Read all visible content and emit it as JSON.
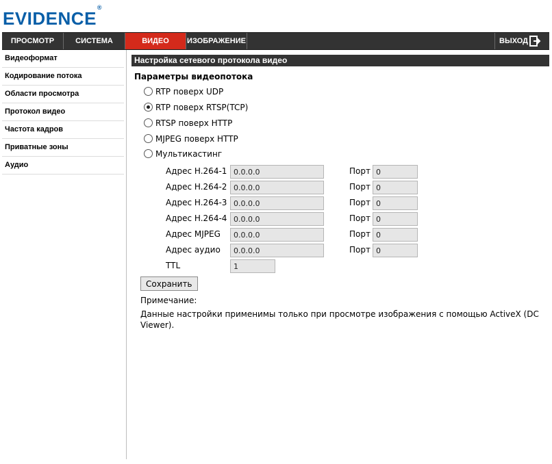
{
  "brand": {
    "logo_text": "EVIDENCE",
    "logo_mark": "®",
    "color": "#0a5fa8"
  },
  "topnav": {
    "tabs": [
      {
        "label": "ПРОСМОТР",
        "active": false
      },
      {
        "label": "СИСТЕМА",
        "active": false
      },
      {
        "label": "ВИДЕО",
        "active": true
      },
      {
        "label": "ИЗОБРАЖЕНИЕ",
        "active": false
      }
    ],
    "logout_label": "ВЫХОД",
    "logout_icon": "exit-icon",
    "active_color": "#d42a1b"
  },
  "sidebar": {
    "items": [
      {
        "label": "Видеоформат"
      },
      {
        "label": "Кодирование потока"
      },
      {
        "label": "Области просмотра"
      },
      {
        "label": "Протокол видео"
      },
      {
        "label": "Частота кадров"
      },
      {
        "label": "Приватные зоны"
      },
      {
        "label": "Аудио"
      }
    ]
  },
  "main": {
    "section_title": "Настройка сетевого протокола видео",
    "subheading": "Параметры видеопотока",
    "protocols": [
      {
        "label": "RTP поверх UDP",
        "checked": false
      },
      {
        "label": "RTP поверх RTSP(TCP)",
        "checked": true
      },
      {
        "label": "RTSP поверх HTTP",
        "checked": false
      },
      {
        "label": "MJPEG поверх HTTP",
        "checked": false
      },
      {
        "label": "Мультикастинг",
        "checked": false
      }
    ],
    "multicast": {
      "rows": [
        {
          "label": "Адрес H.264-1",
          "address": "0.0.0.0",
          "port_label": "Порт",
          "port": "0"
        },
        {
          "label": "Адрес H.264-2",
          "address": "0.0.0.0",
          "port_label": "Порт",
          "port": "0"
        },
        {
          "label": "Адрес H.264-3",
          "address": "0.0.0.0",
          "port_label": "Порт",
          "port": "0"
        },
        {
          "label": "Адрес H.264-4",
          "address": "0.0.0.0",
          "port_label": "Порт",
          "port": "0"
        },
        {
          "label": "Адрес MJPEG",
          "address": "0.0.0.0",
          "port_label": "Порт",
          "port": "0"
        },
        {
          "label": "Адрес аудио",
          "address": "0.0.0.0",
          "port_label": "Порт",
          "port": "0"
        }
      ],
      "ttl_label": "TTL",
      "ttl_value": "1"
    },
    "save_label": "Сохранить",
    "note_label": "Примечание:",
    "note_text": "Данные настройки применимы только при просмотре изображения с помощью ActiveX (DC Viewer)."
  }
}
